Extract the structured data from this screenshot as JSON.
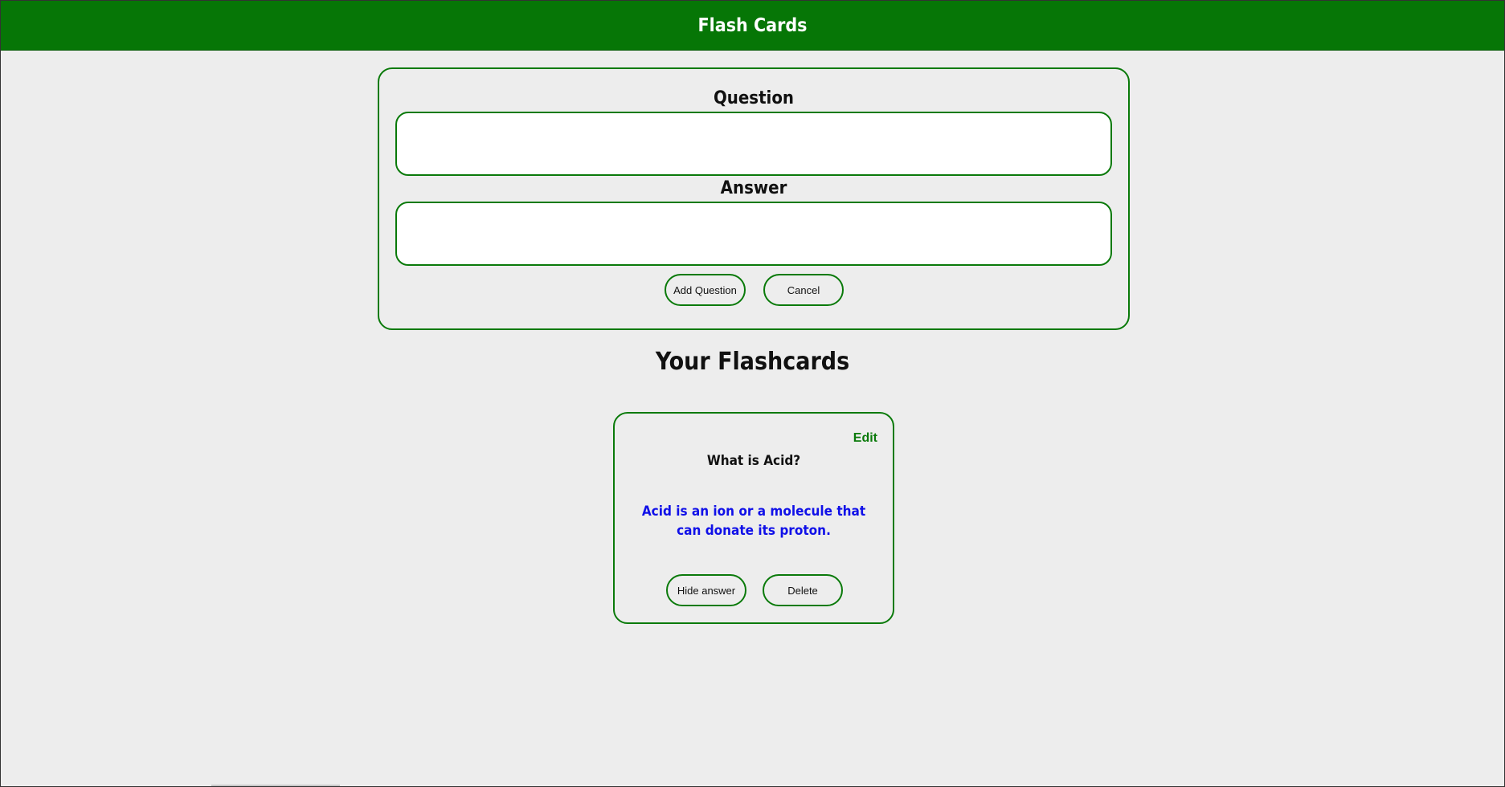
{
  "header": {
    "title": "Flash Cards"
  },
  "form": {
    "question_label": "Question",
    "question_value": "",
    "answer_label": "Answer",
    "answer_value": "",
    "add_button_label": "Add Question",
    "cancel_button_label": "Cancel"
  },
  "flashcards": {
    "section_title": "Your Flashcards",
    "cards": [
      {
        "edit_label": "Edit",
        "question": "What is Acid?",
        "answer": "Acid is an ion or a molecule that can donate its proton.",
        "hide_button_label": "Hide answer",
        "delete_button_label": "Delete"
      }
    ]
  },
  "colors": {
    "accent_green": "#067606",
    "border_green": "#0a7a0a",
    "answer_blue": "#1010e8",
    "background": "#ededed"
  }
}
